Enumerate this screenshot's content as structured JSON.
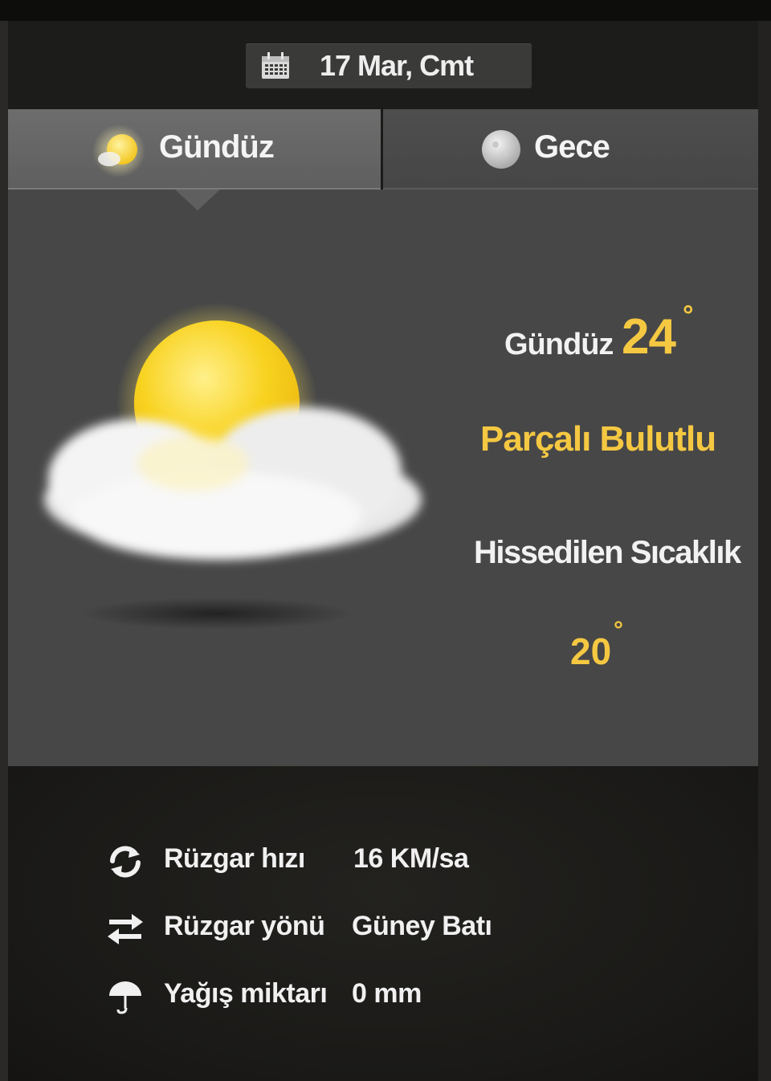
{
  "date": {
    "icon": "calendar-icon",
    "label": "17 Mar, Cmt"
  },
  "tabs": [
    {
      "label": "Gündüz",
      "icon": "sun-icon",
      "active": true
    },
    {
      "label": "Gece",
      "icon": "moon-icon",
      "active": false
    }
  ],
  "forecast": {
    "icon": "partly-cloudy-icon",
    "temp_label": "Gündüz",
    "temp_value": "24",
    "degree": "°",
    "condition": "Parçalı Bulutlu",
    "feels_label": "Hissedilen Sıcaklık",
    "feels_value": "20"
  },
  "details": [
    {
      "icon": "refresh-icon",
      "label": "Rüzgar hızı",
      "value": "16 KM/sa"
    },
    {
      "icon": "swap-arrows-icon",
      "label": "Rüzgar yönü",
      "value": "Güney Batı"
    },
    {
      "icon": "umbrella-icon",
      "label": "Yağış miktarı",
      "value": "0 mm"
    }
  ],
  "colors": {
    "accent": "#f5c842",
    "panel": "#474747",
    "tab_active": "#666666",
    "tab_inactive": "#4a4a4a",
    "background": "#1b1a18"
  }
}
